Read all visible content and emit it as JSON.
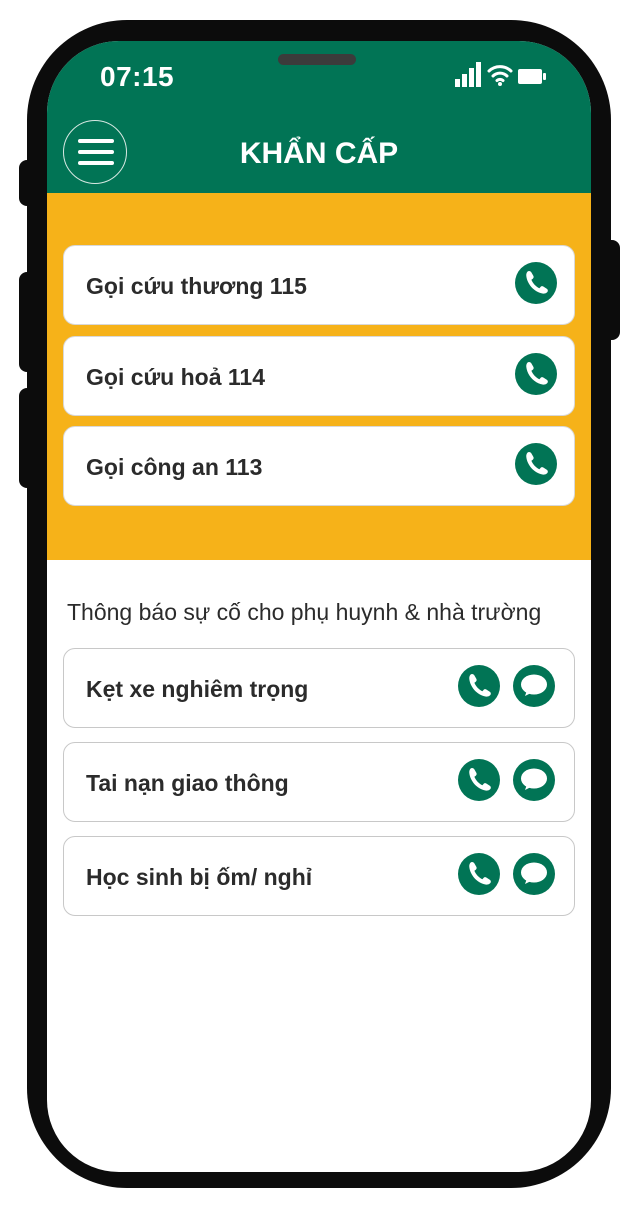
{
  "status_bar": {
    "time": "07:15",
    "icons": [
      "signal-icon",
      "wifi-icon",
      "battery-icon"
    ]
  },
  "header": {
    "title": "KHẨN CẤP",
    "menu_icon": "hamburger-menu-icon"
  },
  "emergency": {
    "items": [
      {
        "label": "Gọi cứu thương 115",
        "action_icon": "phone-icon"
      },
      {
        "label": "Gọi cứu hoả 114",
        "action_icon": "phone-icon"
      },
      {
        "label": "Gọi công an 113",
        "action_icon": "phone-icon"
      }
    ]
  },
  "notify": {
    "title": "Thông báo sự cố cho phụ huynh & nhà trường",
    "items": [
      {
        "label": "Kẹt xe nghiêm trọng",
        "actions": [
          "phone-icon",
          "chat-icon"
        ]
      },
      {
        "label": "Tai nạn giao thông",
        "actions": [
          "phone-icon",
          "chat-icon"
        ]
      },
      {
        "label": "Học sinh bị ốm/ nghỉ",
        "actions": [
          "phone-icon",
          "chat-icon"
        ]
      }
    ]
  },
  "colors": {
    "primary_green": "#017455",
    "accent_yellow": "#f6b219",
    "frame": "#0c0c0c",
    "text_dark": "#2b2b2b"
  }
}
